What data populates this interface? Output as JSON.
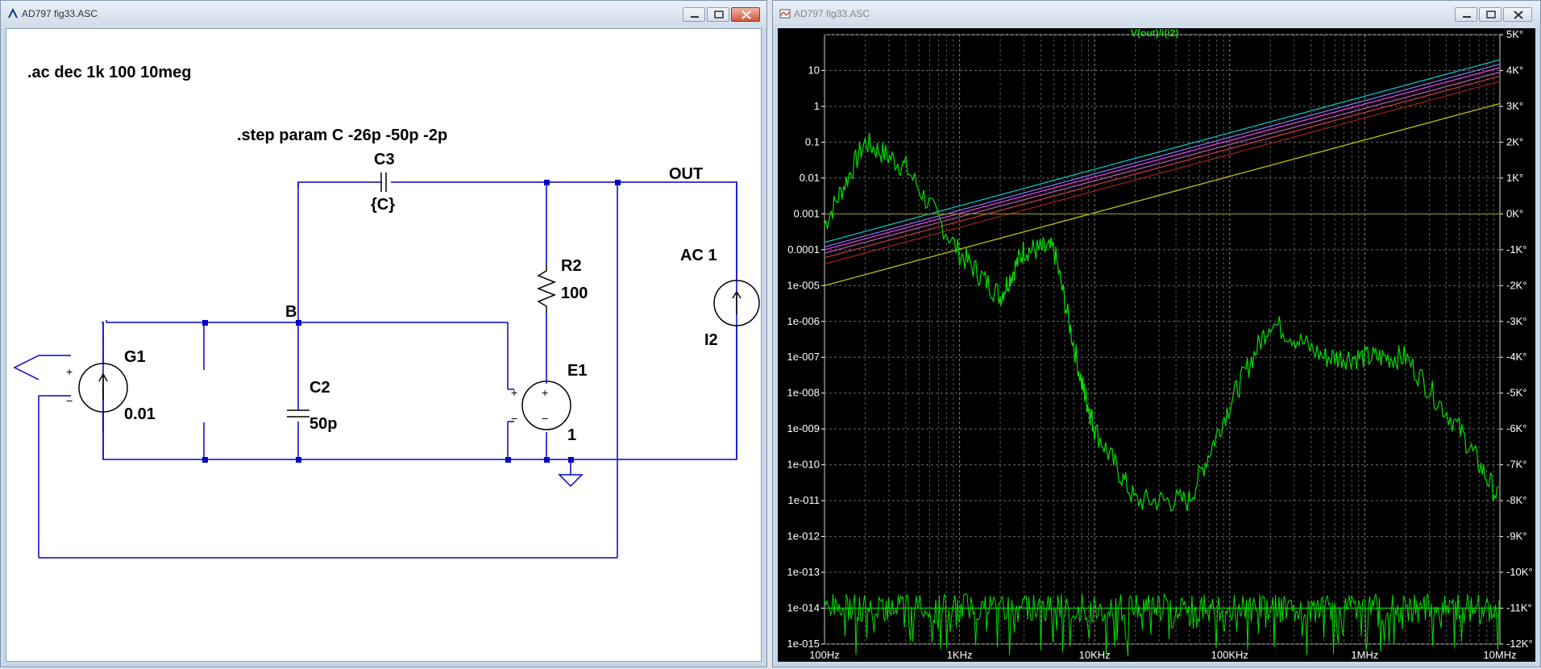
{
  "left_window": {
    "title": "AD797 fig33.ASC",
    "schematic": {
      "directive_ac": ".ac dec 1k 100 10meg",
      "directive_step": ".step param C -26p -50p -2p",
      "c3": {
        "name": "C3",
        "value": "{C}"
      },
      "r2": {
        "name": "R2",
        "value": "100"
      },
      "c2": {
        "name": "C2",
        "value": "50p"
      },
      "g1": {
        "name": "G1",
        "value": "0.01"
      },
      "e1": {
        "name": "E1",
        "value": "1"
      },
      "i2": {
        "name": "I2",
        "value": "AC 1"
      },
      "net_out": "OUT",
      "net_b": "B",
      "plus": "+",
      "minus": "−"
    }
  },
  "right_window": {
    "title": "AD797 fig33.ASC",
    "plot": {
      "trace_label": "V(out)/i(i2)",
      "y_left_ticks": [
        "10",
        "1",
        "0.1",
        "0.01",
        "0.001",
        "0.0001",
        "1e-005",
        "1e-006",
        "1e-007",
        "1e-008",
        "1e-009",
        "1e-010",
        "1e-011",
        "1e-012",
        "1e-013",
        "1e-014",
        "1e-015"
      ],
      "y_right_ticks": [
        "5K°",
        "4K°",
        "3K°",
        "2K°",
        "1K°",
        "0K°",
        "-1K°",
        "-2K°",
        "-3K°",
        "-4K°",
        "-5K°",
        "-6K°",
        "-7K°",
        "-8K°",
        "-9K°",
        "-10K°",
        "-11K°",
        "-12K°"
      ],
      "x_ticks": [
        "100Hz",
        "1KHz",
        "10KHz",
        "100KHz",
        "1MHz",
        "10MHz"
      ]
    }
  },
  "colors": {
    "plot_bg": "#000000",
    "trace_green": "#00e000",
    "wire": "#0000cc",
    "grid": "#808080",
    "window_frame": "#c9d7e6",
    "close_button": "#d0563f"
  },
  "chart_data": {
    "type": "line",
    "title": "V(out)/i(i2)",
    "x_scale": "log",
    "xlim": [
      100,
      10000000
    ],
    "y_scale": "log",
    "ylim": [
      1e-15,
      100
    ],
    "y2lim": [
      -12000,
      5000
    ],
    "grid": true,
    "series": [
      {
        "x": [
          100,
          10000000
        ],
        "y": [
          0.00016,
          20
        ],
        "color": "#00d0d0"
      },
      {
        "x": [
          100,
          10000000
        ],
        "y": [
          0.00012,
          15
        ],
        "color": "#8080ff"
      },
      {
        "x": [
          100,
          10000000
        ],
        "y": [
          0.0001,
          12
        ],
        "color": "#ff40ff"
      },
      {
        "x": [
          100,
          10000000
        ],
        "y": [
          8e-05,
          9
        ],
        "color": "#c060c0"
      },
      {
        "x": [
          100,
          10000000
        ],
        "y": [
          6e-05,
          7
        ],
        "color": "#d04040"
      },
      {
        "x": [
          100,
          10000000
        ],
        "y": [
          4e-05,
          5
        ],
        "color": "#a02020"
      },
      {
        "x": [
          100,
          10000000
        ],
        "y": [
          1e-05,
          1.2
        ],
        "color": "#d0d000"
      },
      {
        "x": [
          100,
          200,
          400,
          1000,
          2000,
          3000,
          5000,
          8000,
          10000,
          20000,
          50000,
          100000,
          200000,
          500000,
          1000000,
          2000000,
          5000000,
          10000000
        ],
        "y": [
          0.0005,
          0.1,
          0.02,
          8e-05,
          5e-06,
          0.0001,
          0.0001,
          2e-08,
          1e-09,
          1e-11,
          1e-11,
          5e-09,
          1e-06,
          1e-07,
          1e-07,
          1e-07,
          1e-09,
          1e-11
        ],
        "color": "#00e000"
      },
      {
        "x": [
          100,
          10000000
        ],
        "y": [
          0.001,
          0.001
        ],
        "color": "#8a8a00"
      },
      {
        "x": [
          100,
          10000000
        ],
        "y": [
          1e-14,
          1e-14
        ],
        "color": "#00e000"
      }
    ]
  }
}
